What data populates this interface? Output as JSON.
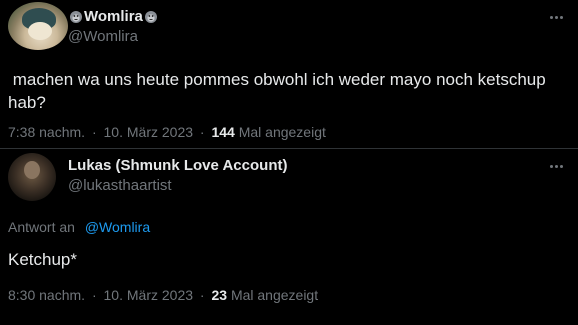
{
  "main_tweet": {
    "display_name": "Womlira",
    "name_emoji": "gorilla",
    "handle": "@Womlira",
    "text": " machen wa uns heute pommes obwohl ich weder mayo noch ketschup\nhab?",
    "time": "7:38 nachm.",
    "date": "10. März 2023",
    "view_count": "144",
    "view_label": "Mal angezeigt",
    "separator": "·"
  },
  "reply_tweet": {
    "display_name": "Lukas (Shmunk Love Account)",
    "handle": "@lukasthaartist",
    "reply_prefix": "Antwort an",
    "reply_mention": "@Womlira",
    "text": "Ketchup*",
    "time": "8:30 nachm.",
    "date": "10. März 2023",
    "view_count": "23",
    "view_label": "Mal angezeigt",
    "separator": "·"
  },
  "colors": {
    "background": "#000000",
    "primary_text": "#e7e9ea",
    "secondary_text": "#71767b",
    "accent": "#1d9bf0",
    "divider": "#2f3336"
  },
  "icons": {
    "more": "more-dots-icon",
    "emoji": "gorilla-emoji-icon"
  }
}
